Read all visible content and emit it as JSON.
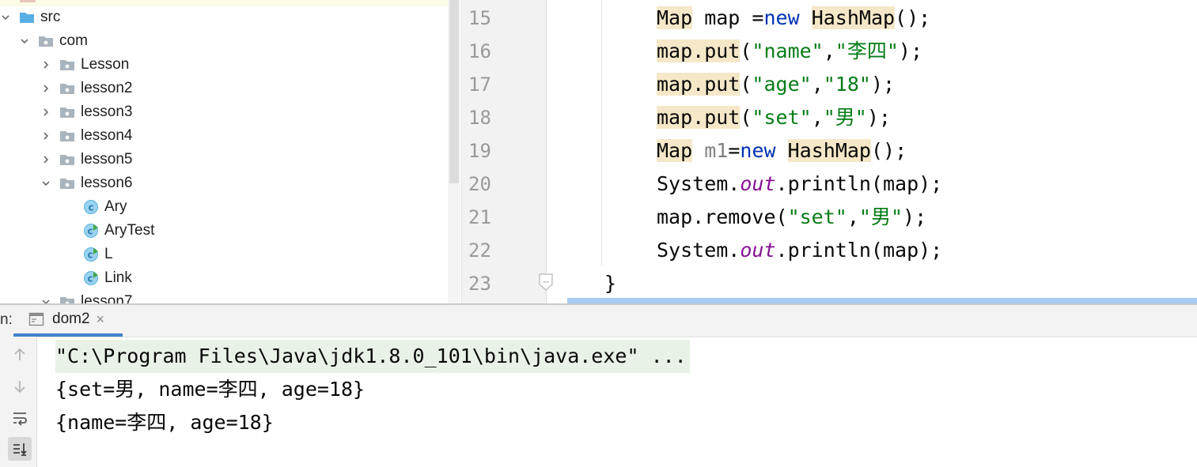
{
  "project_tree": {
    "items": [
      {
        "label": "src",
        "kind": "folder-blue",
        "expanded": true
      },
      {
        "label": "com",
        "kind": "package",
        "expanded": true
      },
      {
        "label": "Lesson",
        "kind": "package",
        "expanded": false
      },
      {
        "label": "lesson2",
        "kind": "package",
        "expanded": false
      },
      {
        "label": "lesson3",
        "kind": "package",
        "expanded": false
      },
      {
        "label": "lesson4",
        "kind": "package",
        "expanded": false
      },
      {
        "label": "lesson5",
        "kind": "package",
        "expanded": false
      },
      {
        "label": "lesson6",
        "kind": "package",
        "expanded": true
      },
      {
        "label": "Ary",
        "kind": "class"
      },
      {
        "label": "AryTest",
        "kind": "class-runnable"
      },
      {
        "label": "L",
        "kind": "class-runnable"
      },
      {
        "label": "Link",
        "kind": "class-runnable"
      },
      {
        "label": "lesson7",
        "kind": "package",
        "expanded": true
      }
    ]
  },
  "editor": {
    "line_numbers": [
      "15",
      "16",
      "17",
      "18",
      "19",
      "20",
      "21",
      "22",
      "23"
    ],
    "lines": {
      "l15": {
        "t1": "Map",
        "t2": " map =",
        "t3": "new",
        "t4": " ",
        "t5": "HashMap",
        "t6": "();"
      },
      "l16": {
        "t1": "map.put",
        "t2": "(",
        "t3": "\"name\"",
        "t4": ",",
        "t5": "\"李四\"",
        "t6": ");"
      },
      "l17": {
        "t1": "map.put",
        "t2": "(",
        "t3": "\"age\"",
        "t4": ",",
        "t5": "\"18\"",
        "t6": ");"
      },
      "l18": {
        "t1": "map.put",
        "t2": "(",
        "t3": "\"set\"",
        "t4": ",",
        "t5": "\"男\"",
        "t6": ");"
      },
      "l19": {
        "t1": "Map",
        "t2": " ",
        "t3": "m1",
        "t4": "=",
        "t5": "new",
        "t6": " ",
        "t7": "HashMap",
        "t8": "();"
      },
      "l20": {
        "t1": "System.",
        "t2": "out",
        "t3": ".println(map);"
      },
      "l21": {
        "t1": "map.remove(",
        "t2": "\"set\"",
        "t3": ",",
        "t4": "\"男\"",
        "t5": ");"
      },
      "l22": {
        "t1": "System.",
        "t2": "out",
        "t3": ".println(map);"
      },
      "l23": {
        "t1": "}"
      }
    }
  },
  "run_panel": {
    "prefix": "n:",
    "tab_label": "dom2",
    "tab_close": "×",
    "output": [
      "\"C:\\Program Files\\Java\\jdk1.8.0_101\\bin\\java.exe\" ...",
      "{set=男, name=李四, age=18}",
      "{name=李四, age=18}"
    ]
  },
  "icons": {
    "tree": [
      "chevron-down-icon",
      "chevron-right-icon",
      "folder-icon",
      "package-icon",
      "class-icon",
      "runnable-class-icon"
    ],
    "run_tools": [
      "arrow-up-icon",
      "arrow-down-icon",
      "soft-wrap-icon",
      "scroll-to-end-icon"
    ]
  },
  "colors": {
    "keyword": "#0033b3",
    "string": "#067d17",
    "static_field": "#871094",
    "type_highlight": "#f5e8c8",
    "accent": "#4083c9"
  }
}
